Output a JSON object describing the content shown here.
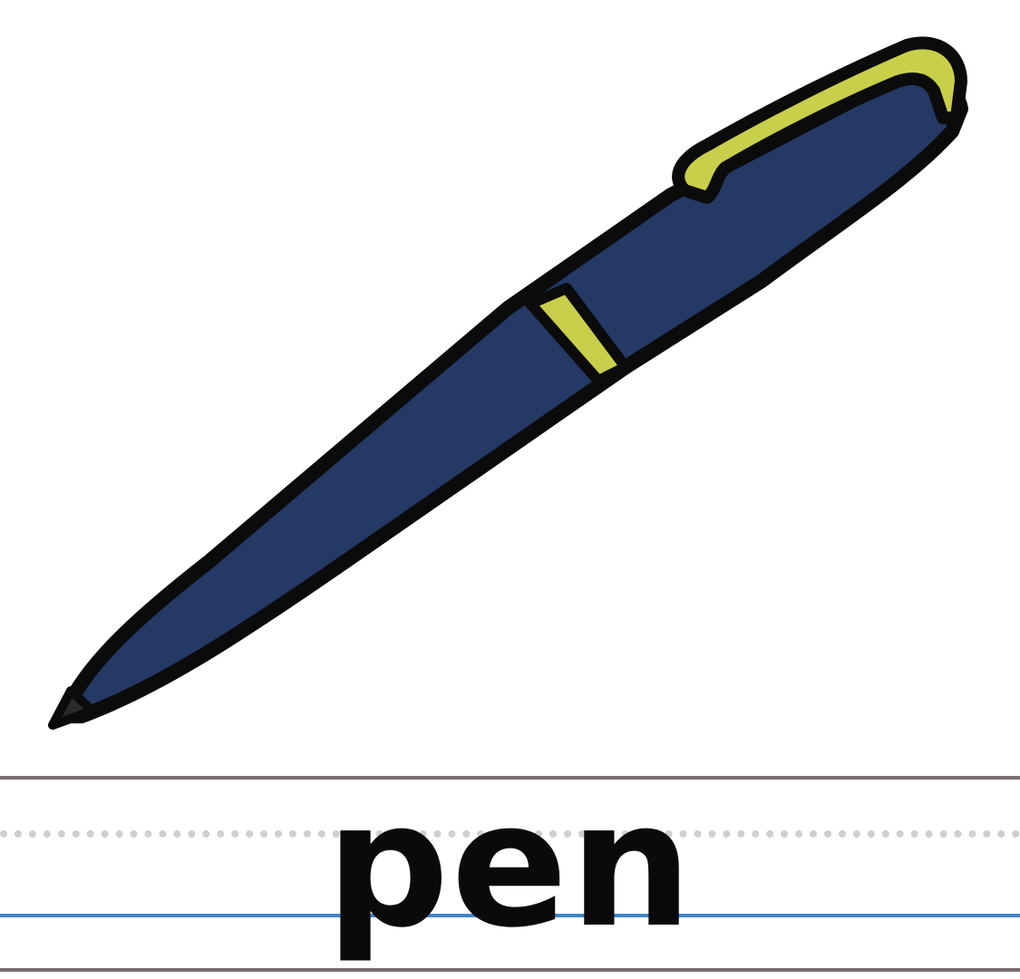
{
  "word": "pen",
  "colors": {
    "pen_body": "#243965",
    "pen_trim": "#c9cf4a",
    "outline": "#0b0b0b",
    "tip": "#2a2a2a",
    "solid_line": "#7a6f6f",
    "dotted_line": "#cfcfcf",
    "baseline": "#3f86c8",
    "text": "#0a0a0a"
  },
  "icons": {
    "illustration": "pen-icon"
  }
}
